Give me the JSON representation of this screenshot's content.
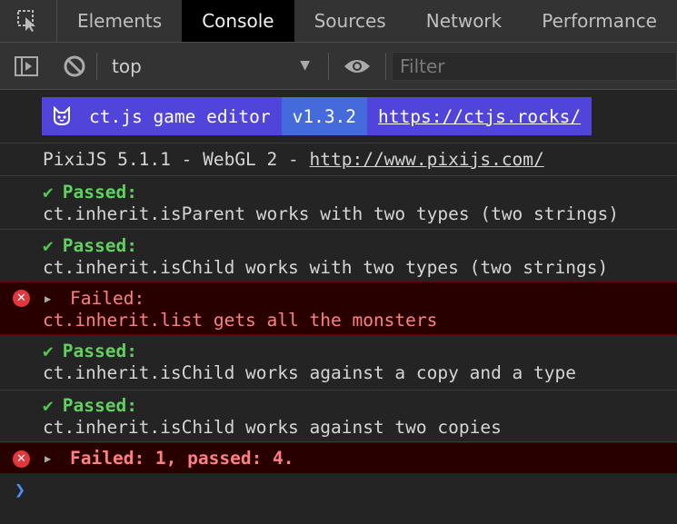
{
  "tabs": [
    {
      "label": "Elements"
    },
    {
      "label": "Console"
    },
    {
      "label": "Sources"
    },
    {
      "label": "Network"
    },
    {
      "label": "Performance"
    }
  ],
  "toolbar": {
    "context": "top",
    "filter_placeholder": "Filter"
  },
  "console": {
    "banner": {
      "name": "ct.js game editor",
      "version": "v1.3.2",
      "link": "https://ctjs.rocks/"
    },
    "pixi": {
      "text": "PixiJS 5.1.1 - WebGL 2 - ",
      "link": "http://www.pixijs.com/"
    },
    "messages": [
      {
        "status": "Passed:",
        "text": "ct.inherit.isParent works with two types (two strings)"
      },
      {
        "status": "Passed:",
        "text": "ct.inherit.isChild works with two types (two strings)"
      },
      {
        "status": "Failed:",
        "text": "ct.inherit.list gets all the monsters"
      },
      {
        "status": "Passed:",
        "text": "ct.inherit.isChild works against a copy and a type"
      },
      {
        "status": "Passed:",
        "text": "ct.inherit.isChild works against two copies"
      }
    ],
    "summary": "Failed: 1, passed: 4.",
    "check_glyph": "✔",
    "error_glyph": "✕",
    "expand_glyph": "▶",
    "prompt_glyph": "❯"
  },
  "colors": {
    "passed": "#5fd15f",
    "failed": "#ff8080",
    "error_bg": "#290000",
    "banner_purple": "#5144db",
    "banner_blue": "#446adb",
    "prompt": "#4f8df7"
  }
}
